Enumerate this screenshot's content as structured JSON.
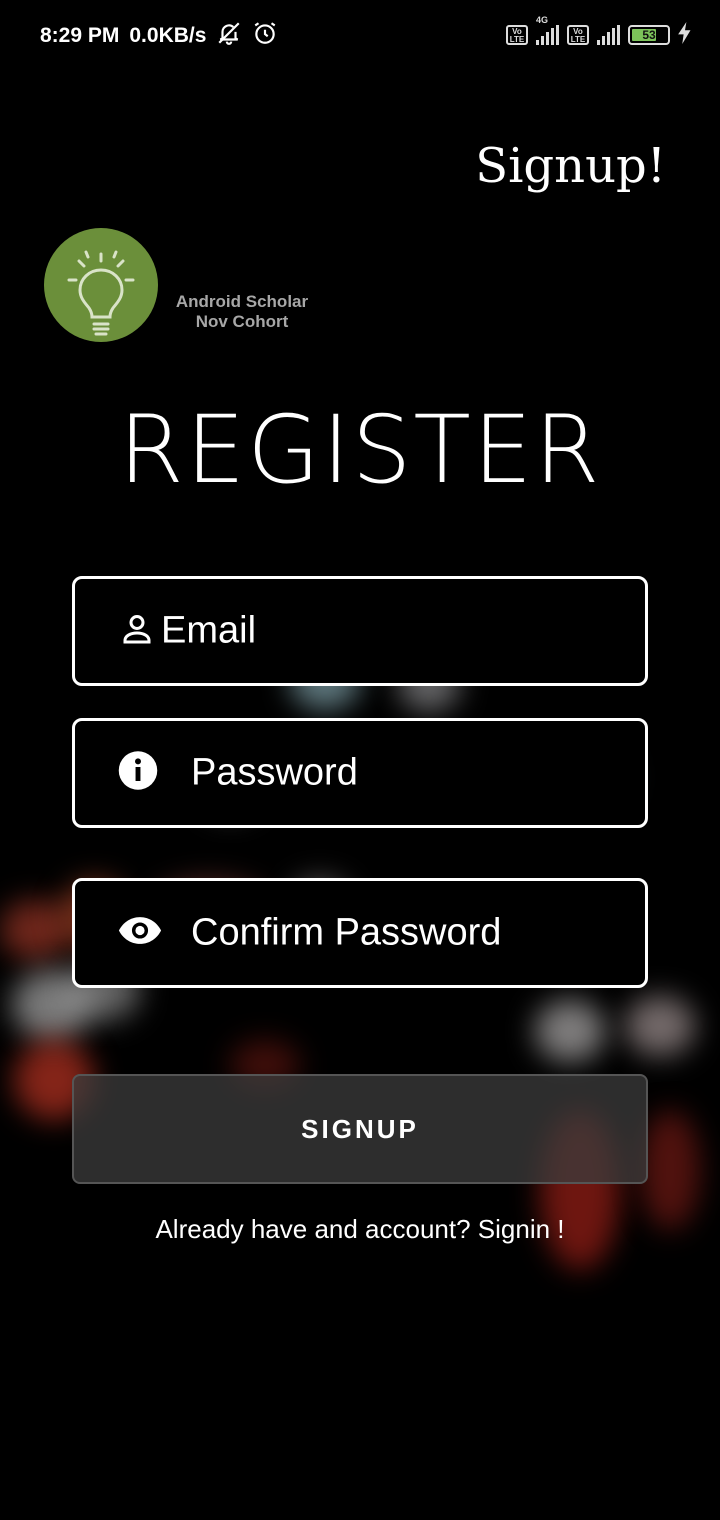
{
  "status_bar": {
    "time": "8:29 PM",
    "speed": "0.0KB/s",
    "icons": [
      "bell-muted-icon",
      "alarm-icon",
      "volte-icon",
      "signal-4g-icon",
      "volte-icon",
      "signal-icon",
      "battery-icon",
      "charging-icon"
    ],
    "network_1": "4G",
    "volte_label": "Vo LTE",
    "battery_level": "53"
  },
  "header": {
    "title": "Signup!"
  },
  "logo": {
    "line1": "Android Scholar",
    "line2": "Nov Cohort",
    "icon": "lightbulb-icon",
    "color": "#6b8f3a"
  },
  "form": {
    "heading": "REGISTER",
    "email": {
      "placeholder": "Email",
      "icon": "person-icon"
    },
    "password": {
      "placeholder": "Password",
      "icon": "info-icon"
    },
    "confirm_password": {
      "placeholder": "Confirm Password",
      "icon": "eye-icon"
    },
    "submit_label": "SIGNUP",
    "signin_prompt": "Already have and account? Signin !"
  }
}
